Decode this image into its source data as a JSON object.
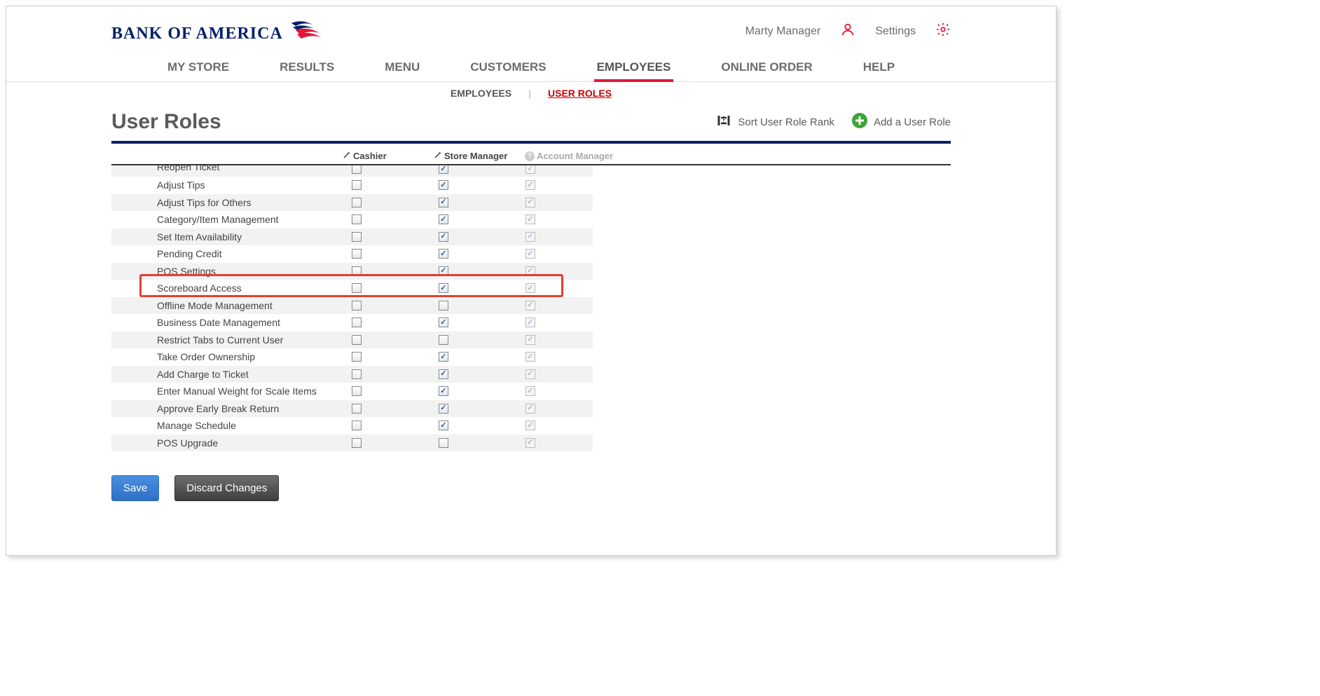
{
  "header": {
    "logo_text": "BANK OF AMERICA",
    "user_name": "Marty Manager",
    "settings_label": "Settings"
  },
  "nav": {
    "items": [
      "MY STORE",
      "RESULTS",
      "MENU",
      "CUSTOMERS",
      "EMPLOYEES",
      "ONLINE ORDER",
      "HELP"
    ],
    "active_index": 4
  },
  "subnav": {
    "items": [
      "EMPLOYEES",
      "USER ROLES"
    ],
    "active_index": 1
  },
  "page": {
    "title": "User Roles",
    "sort_label": "Sort User Role Rank",
    "add_label": "Add a User Role"
  },
  "columns": [
    {
      "label": "Cashier",
      "editable": true
    },
    {
      "label": "Store Manager",
      "editable": true
    },
    {
      "label": "Account Manager",
      "editable": false
    }
  ],
  "rows": [
    {
      "label": "Reopen Ticket",
      "c": [
        false,
        true,
        true
      ],
      "partial": true
    },
    {
      "label": "Adjust Tips",
      "c": [
        false,
        true,
        true
      ]
    },
    {
      "label": "Adjust Tips for Others",
      "c": [
        false,
        true,
        true
      ]
    },
    {
      "label": "Category/Item Management",
      "c": [
        false,
        true,
        true
      ]
    },
    {
      "label": "Set Item Availability",
      "c": [
        false,
        true,
        true
      ]
    },
    {
      "label": "Pending Credit",
      "c": [
        false,
        true,
        true
      ]
    },
    {
      "label": "POS Settings",
      "c": [
        false,
        true,
        true
      ],
      "cutoff_bottom": true
    },
    {
      "label": "Scoreboard Access",
      "c": [
        false,
        true,
        true
      ],
      "highlight": true
    },
    {
      "label": "Offline Mode Management",
      "c": [
        false,
        false,
        true
      ]
    },
    {
      "label": "Business Date Management",
      "c": [
        false,
        true,
        true
      ]
    },
    {
      "label": "Restrict Tabs to Current User",
      "c": [
        false,
        false,
        true
      ]
    },
    {
      "label": "Take Order Ownership",
      "c": [
        false,
        true,
        true
      ]
    },
    {
      "label": "Add Charge to Ticket",
      "c": [
        false,
        true,
        true
      ]
    },
    {
      "label": "Enter Manual Weight for Scale Items",
      "c": [
        false,
        true,
        true
      ]
    },
    {
      "label": "Approve Early Break Return",
      "c": [
        false,
        true,
        true
      ]
    },
    {
      "label": "Manage Schedule",
      "c": [
        false,
        true,
        true
      ]
    },
    {
      "label": "POS Upgrade",
      "c": [
        false,
        false,
        true
      ]
    }
  ],
  "buttons": {
    "save": "Save",
    "discard": "Discard Changes"
  }
}
